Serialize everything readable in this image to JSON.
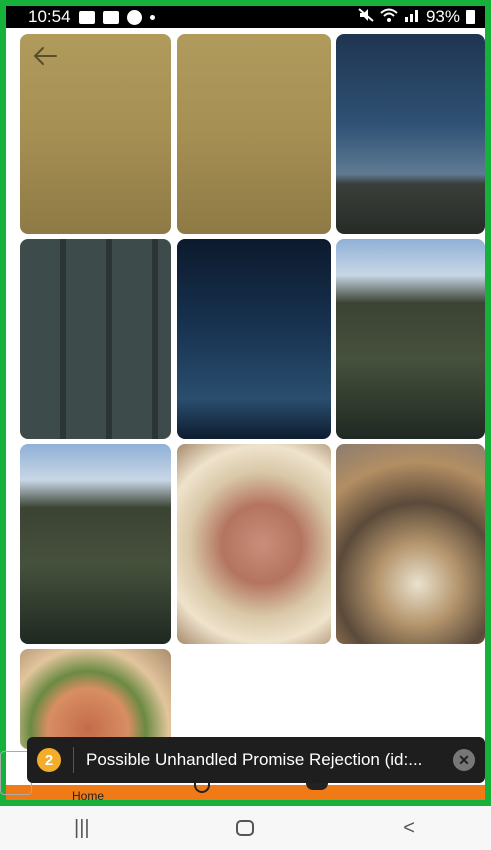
{
  "status_bar": {
    "time": "10:54",
    "battery": "93%",
    "icons": [
      "image-icon",
      "cloud-icon",
      "app-icon",
      "dot-icon",
      "mute-icon",
      "wifi-icon",
      "signal-icon",
      "battery-icon"
    ]
  },
  "gallery": {
    "photos": [
      {
        "subject": "beige blank",
        "row": 1,
        "col": 1
      },
      {
        "subject": "beige blank",
        "row": 1,
        "col": 2
      },
      {
        "subject": "laptop screen with code",
        "row": 1,
        "col": 3
      },
      {
        "subject": "keyboard keys",
        "row": 2,
        "col": 1
      },
      {
        "subject": "code editor screen",
        "row": 2,
        "col": 2
      },
      {
        "subject": "laptop keyboard and screen",
        "row": 2,
        "col": 3
      },
      {
        "subject": "laptop keyboard and screen",
        "row": 3,
        "col": 1
      },
      {
        "subject": "prosciutto pizza",
        "row": 3,
        "col": 2
      },
      {
        "subject": "pizza with parmesan",
        "row": 3,
        "col": 3
      },
      {
        "subject": "margherita pizza",
        "row": 4,
        "col": 1
      }
    ]
  },
  "toast": {
    "count": "2",
    "message": "Possible Unhandled Promise Rejection (id:...",
    "accent_color": "#f2ad2b"
  },
  "tabbar": {
    "home_label": "Home",
    "color": "#f07b16"
  },
  "system_nav": {
    "recents_glyph": "|||",
    "back_glyph": "<"
  },
  "frame_color": "#16b13a"
}
